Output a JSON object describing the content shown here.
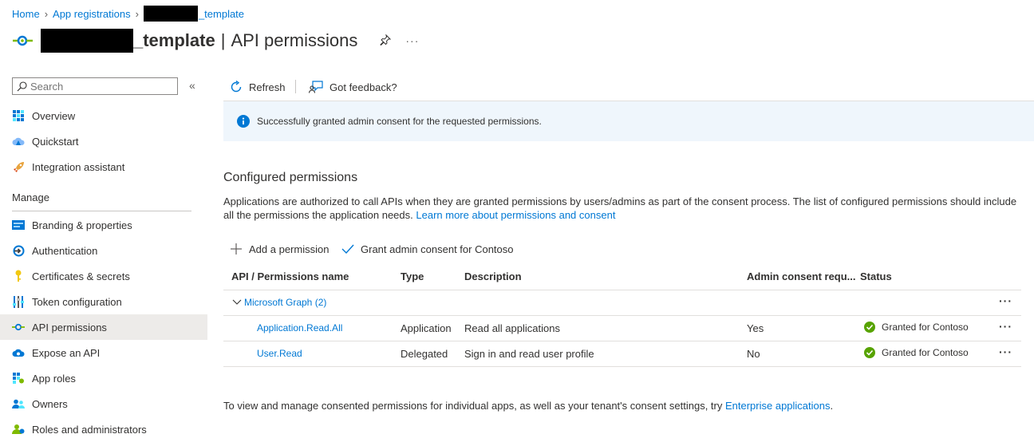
{
  "breadcrumb": {
    "home": "Home",
    "app_registrations": "App registrations",
    "app_suffix": "_template"
  },
  "title": {
    "app_suffix": "_template",
    "separator": "|",
    "page": "API permissions",
    "pin_icon": "pin-icon",
    "more_label": "···"
  },
  "sidebar": {
    "search_placeholder": "Search",
    "collapse_label": "«",
    "items_top": [
      {
        "label": "Overview",
        "icon": "overview-grid-icon"
      },
      {
        "label": "Quickstart",
        "icon": "quickstart-cloud-icon"
      },
      {
        "label": "Integration assistant",
        "icon": "rocket-icon"
      }
    ],
    "section_label": "Manage",
    "items_manage": [
      {
        "label": "Branding & properties",
        "icon": "branding-icon"
      },
      {
        "label": "Authentication",
        "icon": "authentication-icon"
      },
      {
        "label": "Certificates & secrets",
        "icon": "key-icon"
      },
      {
        "label": "Token configuration",
        "icon": "token-config-icon"
      },
      {
        "label": "API permissions",
        "icon": "api-permissions-icon",
        "active": true
      },
      {
        "label": "Expose an API",
        "icon": "expose-api-cloud-icon"
      },
      {
        "label": "App roles",
        "icon": "app-roles-icon"
      },
      {
        "label": "Owners",
        "icon": "owners-icon"
      },
      {
        "label": "Roles and administrators",
        "icon": "roles-admin-icon"
      }
    ]
  },
  "toolbar": {
    "refresh_label": "Refresh",
    "feedback_label": "Got feedback?"
  },
  "banner": {
    "message": "Successfully granted admin consent for the requested permissions."
  },
  "configured": {
    "heading": "Configured permissions",
    "description": "Applications are authorized to call APIs when they are granted permissions by users/admins as part of the consent process. The list of configured permissions should include all the permissions the application needs.",
    "learn_more": "Learn more about permissions and consent",
    "add_permission": "Add a permission",
    "grant_consent": "Grant admin consent for Contoso"
  },
  "table": {
    "headers": [
      "API / Permissions name",
      "Type",
      "Description",
      "Admin consent requ...",
      "Status"
    ],
    "group": {
      "label": "Microsoft Graph (2)"
    },
    "rows": [
      {
        "name": "Application.Read.All",
        "type": "Application",
        "description": "Read all applications",
        "admin_consent": "Yes",
        "status": "Granted for Contoso"
      },
      {
        "name": "User.Read",
        "type": "Delegated",
        "description": "Sign in and read user profile",
        "admin_consent": "No",
        "status": "Granted for Contoso"
      }
    ],
    "more_label": "···"
  },
  "footer": {
    "text": "To view and manage consented permissions for individual apps, as well as your tenant's consent settings, try ",
    "link": "Enterprise applications",
    "end": "."
  },
  "colors": {
    "accent": "#0078d4",
    "success": "#57a300",
    "banner_bg": "#eff6fc",
    "active_nav": "#edebe9"
  }
}
